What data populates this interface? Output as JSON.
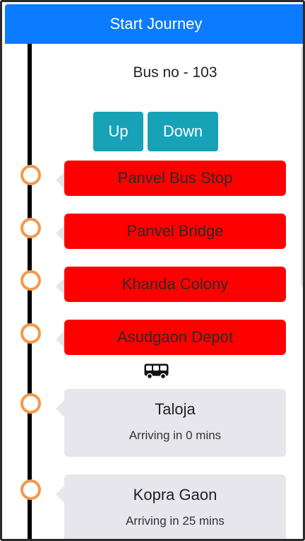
{
  "header": {
    "start_label": "Start Journey"
  },
  "bus": {
    "title": "Bus no - 103"
  },
  "direction": {
    "up_label": "Up",
    "down_label": "Down"
  },
  "stops": [
    {
      "name": "Panvel Bus Stop",
      "status": "passed"
    },
    {
      "name": "Panvel Bridge",
      "status": "passed"
    },
    {
      "name": "Khanda Colony",
      "status": "passed"
    },
    {
      "name": "Asudgaon Depot",
      "status": "passed"
    },
    {
      "name": "Taloja",
      "eta": "Arriving in 0 mins",
      "status": "upcoming"
    },
    {
      "name": "Kopra Gaon",
      "eta": "Arriving in 25 mins",
      "status": "upcoming"
    }
  ],
  "current_position_icon": "bus-icon",
  "colors": {
    "primary": "#0b7bff",
    "direction_button": "#17a2b8",
    "passed_stop": "#ff0000",
    "upcoming_stop": "#e6e6ec",
    "stop_marker": "#f4994a"
  }
}
